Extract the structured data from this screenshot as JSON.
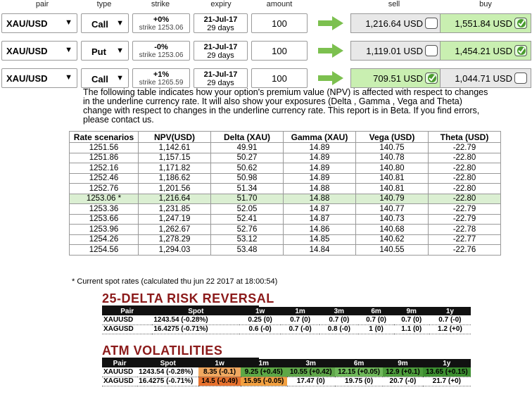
{
  "header": {
    "pair": "pair",
    "type": "type",
    "strike": "strike",
    "expiry": "expiry",
    "amount": "amount",
    "sell": "sell",
    "buy": "buy"
  },
  "options": [
    {
      "pair": "XAU/USD",
      "type": "Call",
      "strike_pct": "+0%",
      "strike_val": "strike 1253.06",
      "expiry_date": "21-Jul-17",
      "expiry_days": "29 days",
      "amount": "100",
      "sell_price": "1,216.64 USD",
      "buy_price": "1,551.84 USD",
      "selected": "buy"
    },
    {
      "pair": "XAU/USD",
      "type": "Put",
      "strike_pct": "-0%",
      "strike_val": "strike 1253.06",
      "expiry_date": "21-Jul-17",
      "expiry_days": "29 days",
      "amount": "100",
      "sell_price": "1,119.01 USD",
      "buy_price": "1,454.21 USD",
      "selected": "buy"
    },
    {
      "pair": "XAU/USD",
      "type": "Call",
      "strike_pct": "+1%",
      "strike_val": "strike 1265.59",
      "expiry_date": "21-Jul-17",
      "expiry_days": "29 days",
      "amount": "100",
      "sell_price": "709.51 USD",
      "buy_price": "1,044.71 USD",
      "selected": "sell"
    }
  ],
  "description": "The following table indicates how your option's premium value (NPV) is affected with respect to changes in the underline currency rate. It will also show your exposures (Delta , Gamma , Vega and Theta) change with respect to changes in the underline currency rate. This report is in Beta. If you find errors, please contact us.",
  "scenario_table": {
    "columns": [
      "Rate scenarios",
      "NPV(USD)",
      "Delta (XAU)",
      "Gamma (XAU)",
      "Vega (USD)",
      "Theta (USD)"
    ],
    "rows": [
      [
        "1251.56",
        "1,142.61",
        "49.91",
        "14.89",
        "140.75",
        "-22.79"
      ],
      [
        "1251.86",
        "1,157.15",
        "50.27",
        "14.89",
        "140.78",
        "-22.80"
      ],
      [
        "1252.16",
        "1,171.82",
        "50.62",
        "14.89",
        "140.80",
        "-22.80"
      ],
      [
        "1252.46",
        "1,186.62",
        "50.98",
        "14.89",
        "140.81",
        "-22.80"
      ],
      [
        "1252.76",
        "1,201.56",
        "51.34",
        "14.88",
        "140.81",
        "-22.80"
      ],
      [
        "1253.06 *",
        "1,216.64",
        "51.70",
        "14.88",
        "140.79",
        "-22.80"
      ],
      [
        "1253.36",
        "1,231.85",
        "52.05",
        "14.87",
        "140.77",
        "-22.79"
      ],
      [
        "1253.66",
        "1,247.19",
        "52.41",
        "14.87",
        "140.73",
        "-22.79"
      ],
      [
        "1253.96",
        "1,262.67",
        "52.76",
        "14.86",
        "140.68",
        "-22.78"
      ],
      [
        "1254.26",
        "1,278.29",
        "53.12",
        "14.85",
        "140.62",
        "-22.77"
      ],
      [
        "1254.56",
        "1,294.03",
        "53.48",
        "14.84",
        "140.55",
        "-22.76"
      ]
    ],
    "highlight_row": 5,
    "footnote": "* Current spot rates (calculated thu jun 22 2017 at 18:00:54)"
  },
  "risk_reversal": {
    "title": "25-DELTA RISK REVERSAL",
    "columns": [
      "Pair",
      "Spot",
      "1w",
      "1m",
      "3m",
      "6m",
      "9m",
      "1y"
    ],
    "rows": [
      [
        "XAUUSD",
        "1243.54 (-0.28%)",
        "0.25 (0)",
        "0.7 (0)",
        "0.7 (0)",
        "0.7 (0)",
        "0.7 (0)",
        "0.7 (-0)"
      ],
      [
        "XAGUSD",
        "16.4275 (-0.71%)",
        "0.6 (-0)",
        "0.7 (-0)",
        "0.8 (-0)",
        "1 (0)",
        "1.1 (0)",
        "1.2 (+0)"
      ]
    ]
  },
  "atm_vol": {
    "title": "ATM VOLATILITIES",
    "columns": [
      "Pair",
      "Spot",
      "1w",
      "1m",
      "3m",
      "6m",
      "9m",
      "1y"
    ],
    "rows": [
      {
        "cells": [
          "XAUUSD",
          "1243.54 (-0.28%)",
          "8.35 (-0.1)",
          "9.25 (+0.45)",
          "10.55 (+0.42)",
          "12.15 (+0.05)",
          "12.9 (+0.1)",
          "13.65 (+0.15)"
        ],
        "colors": [
          "",
          "",
          "#f0a860",
          "#5da845",
          "#5fa64a",
          "#6fb85a",
          "#4d9c3c",
          "#3c8f30"
        ]
      },
      {
        "cells": [
          "XAGUSD",
          "16.4275 (-0.71%)",
          "14.5 (-0.49)",
          "15.95 (-0.05)",
          "17.47 (0)",
          "19.75 (0)",
          "20.7 (-0)",
          "21.7 (+0)"
        ],
        "colors": [
          "",
          "",
          "#e8722e",
          "#f2a040",
          "",
          "",
          "",
          ""
        ]
      }
    ]
  },
  "colors": {
    "arrow": "#7cc04f",
    "selected_price_bg": "#c9efb1",
    "section_title": "#8b1a1a"
  }
}
